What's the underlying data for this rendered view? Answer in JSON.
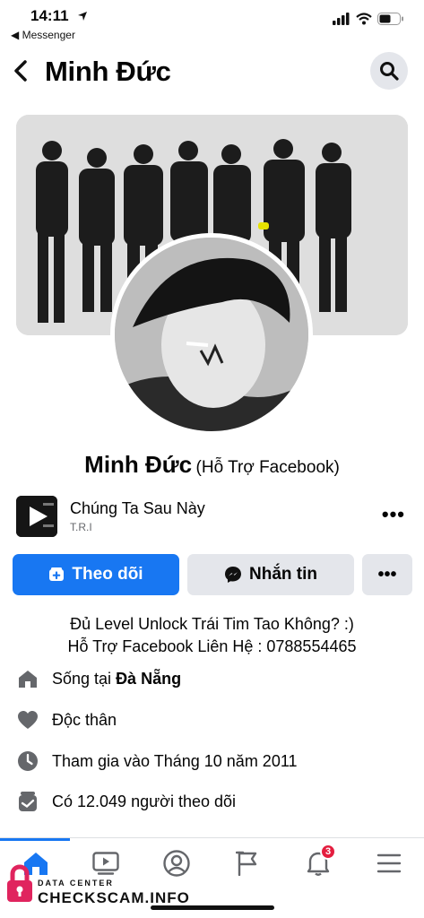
{
  "status_bar": {
    "time": "14:11",
    "back_app": "Messenger"
  },
  "header": {
    "title": "Minh Đức"
  },
  "profile": {
    "name": "Minh Đức",
    "alt_name": "(Hỗ Trợ Facebook)"
  },
  "music": {
    "title": "Chúng Ta Sau Này",
    "artist": "T.R.I"
  },
  "actions": {
    "follow": "Theo dõi",
    "message": "Nhắn tin",
    "more": "•••"
  },
  "bio": {
    "line1": "Đủ Level Unlock Trái Tim Tao Không? :)",
    "line2": "Hỗ Trợ Facebook Liên Hệ : 0788554465"
  },
  "details": [
    {
      "icon": "home-icon",
      "prefix": "Sống tại ",
      "bold": "Đà Nẵng"
    },
    {
      "icon": "heart-icon",
      "prefix": "Độc thân",
      "bold": ""
    },
    {
      "icon": "clock-icon",
      "prefix": "Tham gia vào Tháng 10 năm 2011",
      "bold": ""
    },
    {
      "icon": "followers-icon",
      "prefix": "Có 12.049 người theo dõi",
      "bold": ""
    }
  ],
  "tabbar": {
    "notifications_badge": "3"
  },
  "watermark": {
    "line1": "DATA CENTER",
    "line2": "CHECKSCAM.INFO"
  },
  "colors": {
    "accent": "#1877f2",
    "badge": "#e41e3f",
    "button_gray": "#e4e6eb"
  }
}
